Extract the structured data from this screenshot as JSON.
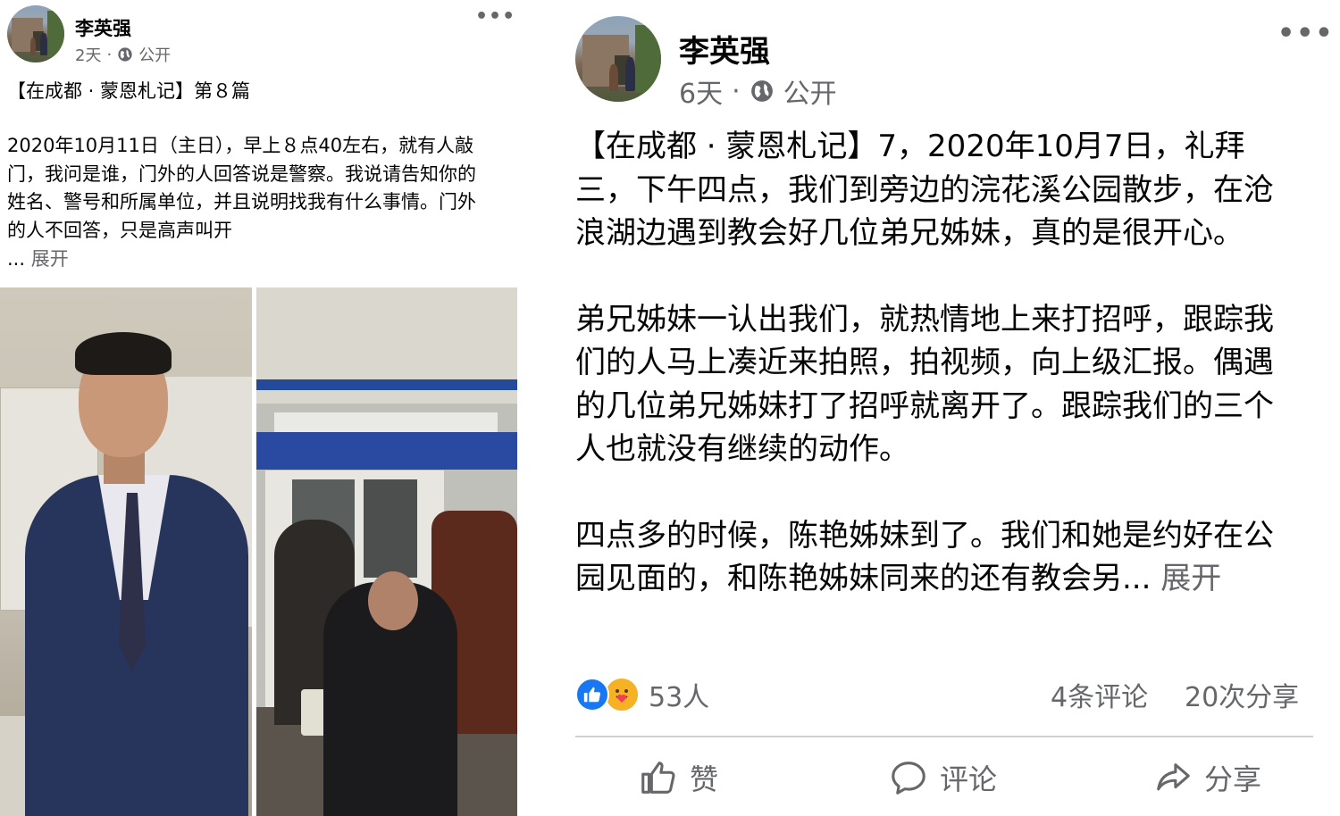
{
  "left_post": {
    "author": "李英强",
    "time": "2天",
    "audience": "公开",
    "heading": "【在成都 · 蒙恩札记】第８篇",
    "body": "2020年10月11日（主日），早上８点40左右，就有人敲门，我问是谁，门外的人回答说是警察。我说请告知你的姓名、警号和所属单位，并且说明找我有什么事情。门外的人不回答，只是高声叫开",
    "ellipsis": "...",
    "expand": "展开",
    "more_icon": "more-horizontal-icon",
    "audience_icon": "globe-icon"
  },
  "right_post": {
    "author": "李英强",
    "time": "6天",
    "audience": "公开",
    "paragraphs": [
      "【在成都 · 蒙恩札记】7，2020年10月7日，礼拜三，下午四点，我们到旁边的浣花溪公园散步，在沧浪湖边遇到教会好几位弟兄姊妹，真的是很开心。",
      "弟兄姊妹一认出我们，就热情地上来打招呼，跟踪我们的人马上凑近来拍照，拍视频，向上级汇报。偶遇的几位弟兄姊妹打了招呼就离开了。跟踪我们的三个人也就没有继续的动作。"
    ],
    "last_paragraph": "四点多的时候，陈艳姊妹到了。我们和她是约好在公园见面的，和陈艳姊妹同来的还有教会另...",
    "expand": "展开",
    "reactions_count": "53人",
    "comments": "4条评论",
    "shares": "20次分享",
    "actions": {
      "like": "赞",
      "comment": "评论",
      "share": "分享"
    },
    "colors": {
      "like_blue": "#1877f2",
      "care_yellow": "#f7b125",
      "secondary_text": "#65676b"
    }
  }
}
